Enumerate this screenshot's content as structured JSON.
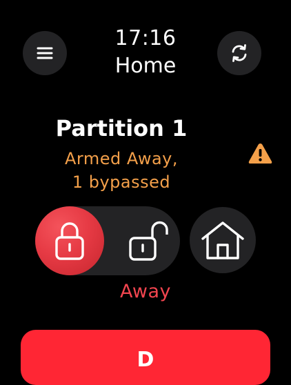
{
  "header": {
    "time": "17:16",
    "title": "Home"
  },
  "partition": {
    "name": "Partition 1",
    "status_line1": "Armed Away,",
    "status_line2": "1 bypassed"
  },
  "mode": {
    "selected_label": "Away"
  },
  "action": {
    "label": "D"
  },
  "icons": {
    "menu": "hamburger-menu-icon",
    "refresh": "refresh-icon",
    "warning": "warning-triangle-icon",
    "locked": "lock-closed-icon",
    "unlocked": "lock-open-icon",
    "home": "house-icon"
  },
  "colors": {
    "background": "#000000",
    "status": "#F4A04A",
    "warning": "#F4A04A",
    "armed_red": "#E63A44",
    "mode_label": "#F2454F",
    "action_button": "#FF2634",
    "control_bg": "#232325"
  }
}
